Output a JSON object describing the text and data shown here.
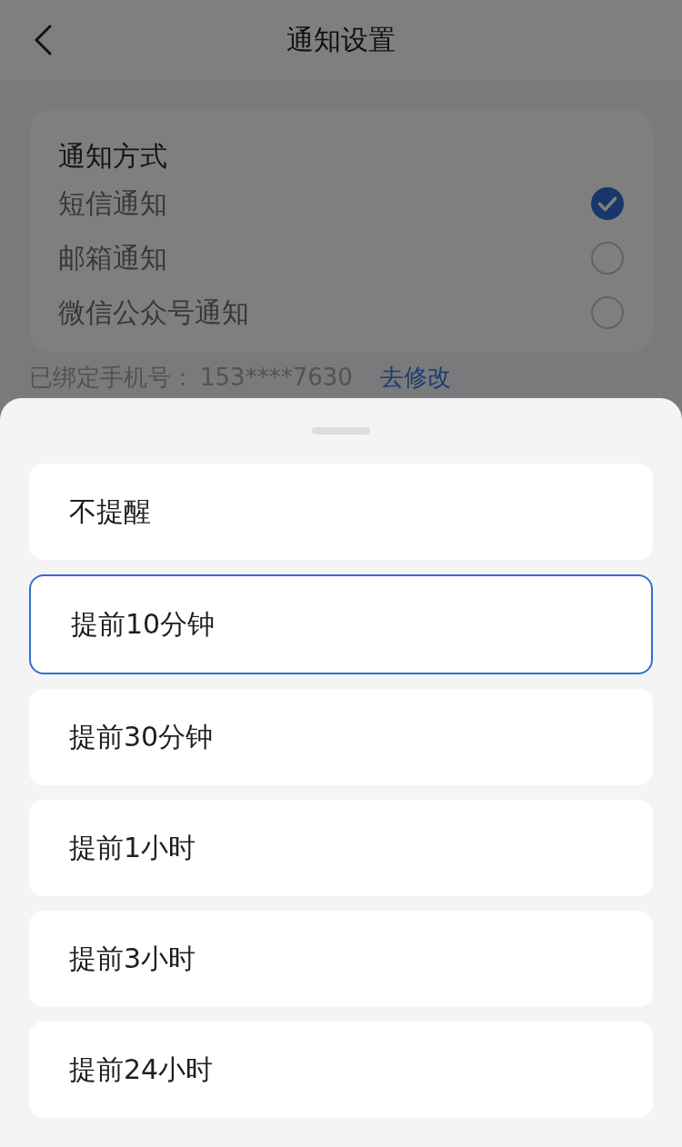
{
  "header": {
    "title": "通知设置"
  },
  "notification_methods": {
    "title": "通知方式",
    "options": [
      {
        "label": "短信通知",
        "selected": true
      },
      {
        "label": "邮箱通知",
        "selected": false
      },
      {
        "label": "微信公众号通知",
        "selected": false
      }
    ]
  },
  "bound_phone": {
    "label": "已绑定手机号：",
    "value": "153****7630",
    "link": "去修改"
  },
  "reminder_sheet": {
    "options": [
      {
        "label": "不提醒",
        "selected": false
      },
      {
        "label": "提前10分钟",
        "selected": true
      },
      {
        "label": "提前30分钟",
        "selected": false
      },
      {
        "label": "提前1小时",
        "selected": false
      },
      {
        "label": "提前3小时",
        "selected": false
      },
      {
        "label": "提前24小时",
        "selected": false
      }
    ]
  }
}
